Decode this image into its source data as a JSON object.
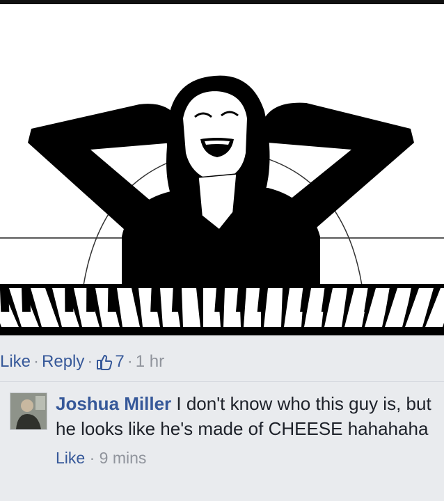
{
  "post_actions": {
    "like_label": "Like",
    "reply_label": "Reply",
    "like_count": "7",
    "timestamp": "1 hr",
    "separator": "·"
  },
  "comment": {
    "author": "Joshua Miller",
    "text": "I don't know who this guy is, but he looks like he's made of CHEESE hahahaha",
    "like_label": "Like",
    "timestamp": "9 mins",
    "separator": "·"
  },
  "colors": {
    "link": "#365899",
    "meta": "#90949c",
    "text": "#1d2129",
    "background": "#e9ebee"
  },
  "icons": {
    "like_count_icon": "thumbs-up-icon"
  }
}
